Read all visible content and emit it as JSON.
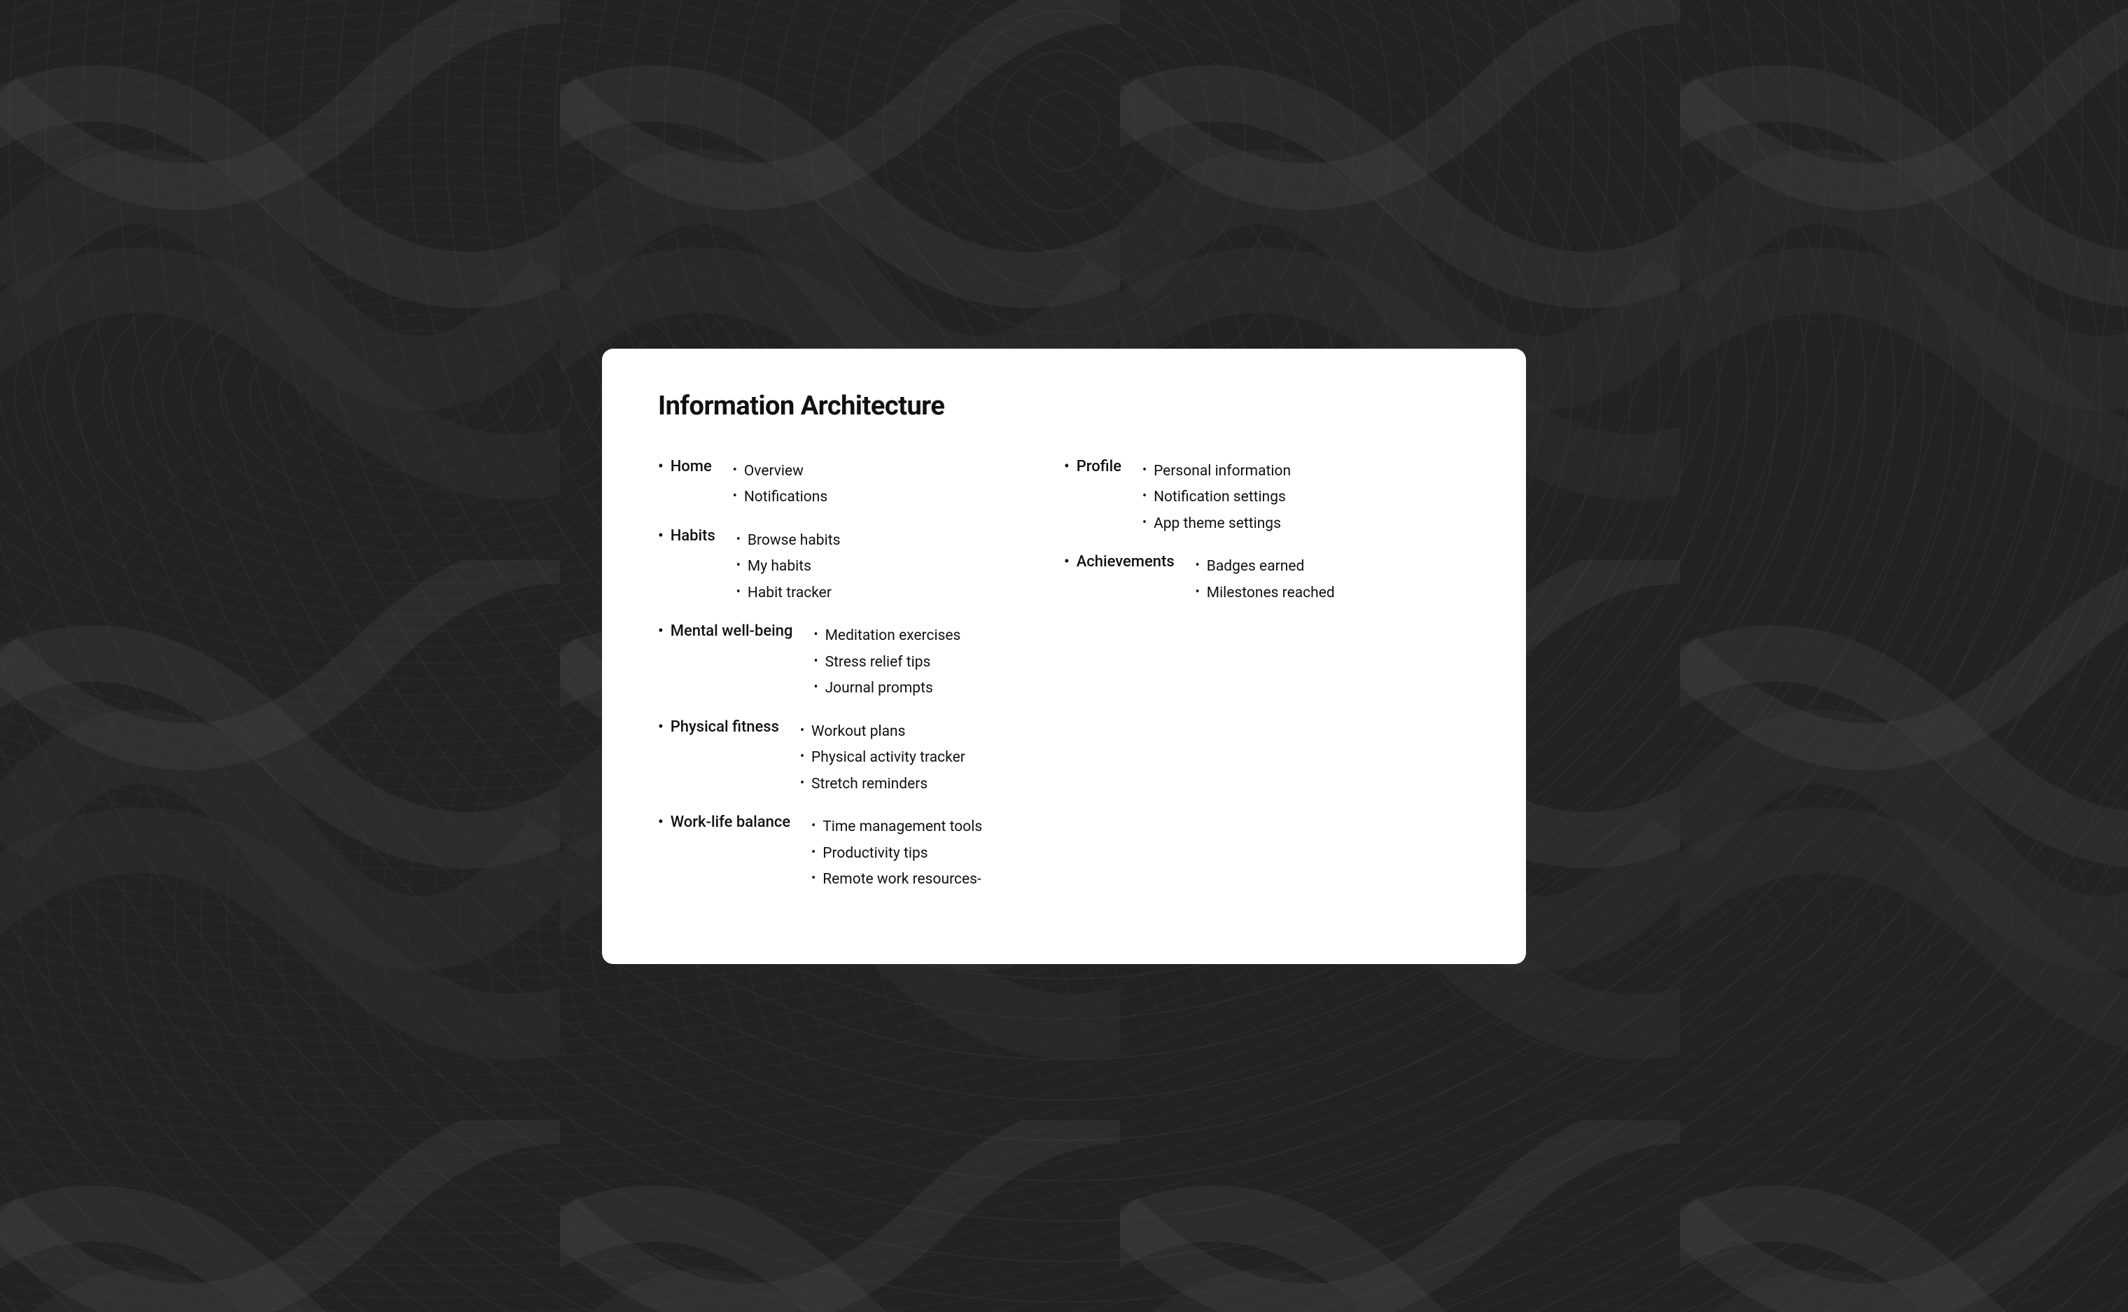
{
  "page": {
    "title": "Information Architecture"
  },
  "column_left": {
    "sections": [
      {
        "label": "Home",
        "children": [
          "Overview",
          "Notifications"
        ]
      },
      {
        "label": "Habits",
        "children": [
          "Browse habits",
          "My habits",
          "Habit tracker"
        ]
      },
      {
        "label": "Mental well-being",
        "children": [
          "Meditation exercises",
          "Stress relief tips",
          "Journal prompts"
        ]
      },
      {
        "label": "Physical fitness",
        "children": [
          "Workout plans",
          "Physical activity tracker",
          "Stretch reminders"
        ]
      },
      {
        "label": "Work-life balance",
        "children": [
          "Time management tools",
          "Productivity tips",
          "Remote work resources-"
        ]
      }
    ]
  },
  "column_right": {
    "sections": [
      {
        "label": "Profile",
        "children": [
          "Personal information",
          "Notification settings",
          "App theme settings"
        ]
      },
      {
        "label": "Achievements",
        "children": [
          "Badges earned",
          "Milestones reached"
        ]
      }
    ]
  }
}
